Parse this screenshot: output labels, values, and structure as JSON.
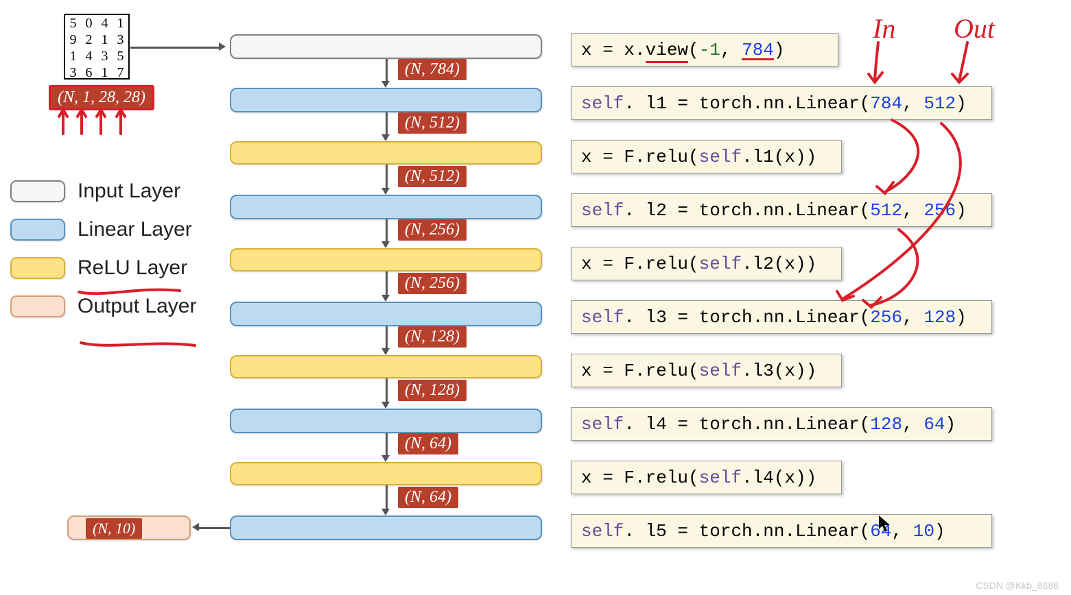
{
  "input_shape_tag": "(N, 1, 28, 28)",
  "input_digits": [
    "5",
    "0",
    "4",
    "1",
    "9",
    "2",
    "1",
    "3",
    "1",
    "4",
    "3",
    "5",
    "3",
    "6",
    "1",
    "7"
  ],
  "legend": {
    "input": "Input Layer",
    "linear": "Linear Layer",
    "relu": "ReLU Layer",
    "output": "Output Layer"
  },
  "center_tags": {
    "t1": "(N, 784)",
    "t2": "(N, 512)",
    "t3": "(N, 512)",
    "t4": "(N, 256)",
    "t5": "(N, 256)",
    "t6": "(N, 128)",
    "t7": "(N, 128)",
    "t8": "(N, 64)",
    "t9": "(N, 64)",
    "out": "(N, 10)"
  },
  "code": {
    "c1_pre": "x = x.",
    "c1_fn": "view",
    "c1_open": "(",
    "c1_a": "-1",
    "c1_sep": ", ",
    "c1_b": "784",
    "c1_close": ")",
    "c2_self": "self",
    "c2_rest": ". l1 = torch.nn.Linear(",
    "c2_a": "784",
    "c2_sep": ", ",
    "c2_b": "512",
    "c2_close": ")",
    "c3_pre": "x = F.relu(",
    "c3_self": "self",
    "c3_rest": ".l1(x))",
    "c4_self": "self",
    "c4_rest": ". l2 = torch.nn.Linear(",
    "c4_a": "512",
    "c4_sep": ",  ",
    "c4_b": "256",
    "c4_close": ")",
    "c5_pre": "x = F.relu(",
    "c5_self": "self",
    "c5_rest": ".l2(x))",
    "c6_self": "self",
    "c6_rest": ". l3 = torch.nn.Linear(",
    "c6_a": "256",
    "c6_sep": ",  ",
    "c6_b": "128",
    "c6_close": ")",
    "c7_pre": "x = F.relu(",
    "c7_self": "self",
    "c7_rest": ".l3(x))",
    "c8_self": "self",
    "c8_rest": ". l4 = torch.nn.Linear(",
    "c8_a": "128",
    "c8_sep": ",  ",
    "c8_b": "64",
    "c8_close": ")",
    "c9_pre": "x = F.relu(",
    "c9_self": "self",
    "c9_rest": ".l4(x))",
    "c10_self": "self",
    "c10_rest": ". l5 = torch.nn.Linear(",
    "c10_a": "64",
    "c10_sep": ",  ",
    "c10_b": "10",
    "c10_close": ")"
  },
  "hand": {
    "in_label": "In",
    "out_label": "Out"
  },
  "watermark": "CSDN @Kkb_8686"
}
